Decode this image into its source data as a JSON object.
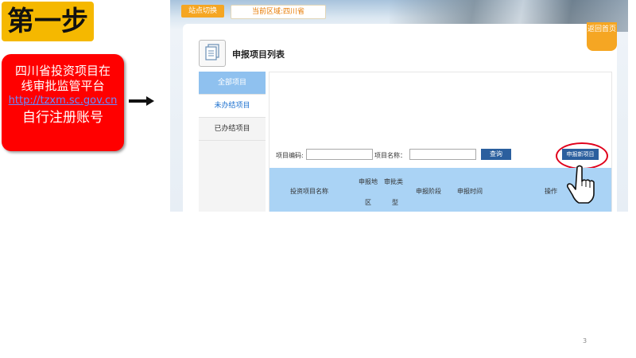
{
  "slide": {
    "step_title": "第一步",
    "platform_line1": "四川省投资项目在",
    "platform_line2": "线审批监管平台",
    "platform_url": "http://tzxm.sc.gov.cn",
    "register_text": "自行注册账号",
    "page_number": "3"
  },
  "screenshot": {
    "topbar": {
      "switch_site": "站点切换",
      "current_region": "当前区域:四川省"
    },
    "back_home": "返回首页",
    "page_title": "申报项目列表",
    "nav": [
      "全部项目",
      "未办结项目",
      "已办结项目"
    ],
    "search": {
      "code_label": "项目编码:",
      "name_label": "项目名称：",
      "query_button": "查询",
      "new_button": "申报新项目"
    },
    "table_headers": {
      "project_name": "投资项目名称",
      "region_a": "申报地",
      "region_b": "区",
      "type_a": "审批类",
      "type_b": "型",
      "stage": "申报阶段",
      "time": "申报时间",
      "action": "操作"
    }
  },
  "colors": {
    "step_bg": "#f5b800",
    "red_box": "#ff0000",
    "accent_orange": "#f5a623",
    "button_blue": "#2b5f9e",
    "table_head": "#aad3f5",
    "highlight_ring": "#e0001b"
  }
}
